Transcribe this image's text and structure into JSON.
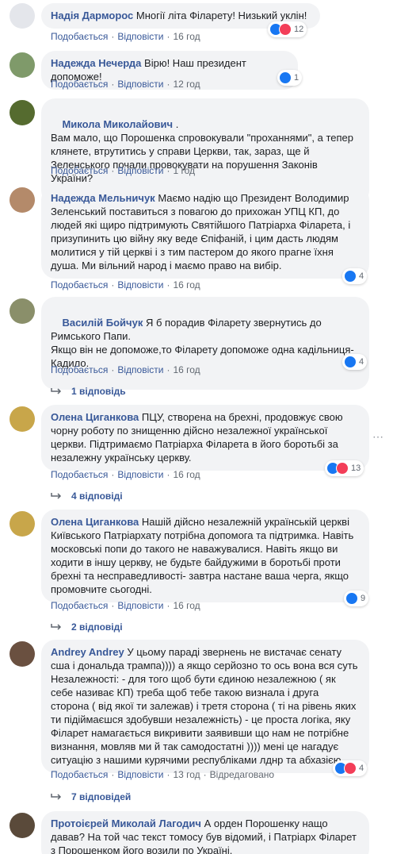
{
  "labels": {
    "like": "Подобається",
    "reply": "Відповісти",
    "edited": "Відредаговано"
  },
  "comments": [
    {
      "author": "Надія Дарморос",
      "text": "Многії літа Філарету! Низький уклін!",
      "time": "16 год",
      "reactions": "12"
    },
    {
      "author": "Надежда Нечерда",
      "text": "Вірю! Наш президент допоможе!",
      "time": "12 год",
      "reactions": "1"
    },
    {
      "author": "Микола Миколайович",
      "text": ".\nВам мало, що Порошенка спровокували \"проханнями\", а тепер клянете, втрутитись у справи Церкви, так, зараз, ще й Зеленського почали провокувати на порушення Законів України?",
      "time": "1 год",
      "reactions": ""
    },
    {
      "author": "Надежда Мельничук",
      "text": "Маємо надію що Президент Володимир Зеленський поставиться з повагою до прихожан УПЦ КП, до людей які щиро підтримують Святійшого Патріарха Філарета, і призупинить цю війну яку веде Єпіфаній, і цим дасть людям молитися у тій церкві і з тим пастером до якого прагне їхня душа. Ми вільний народ і маємо право на вибір.",
      "time": "16 год",
      "reactions": "4"
    },
    {
      "author": "Василій Бойчук",
      "text": "Я б порадив Філарету звернутись до Римського Папи.\nЯкщо він не допоможе,то Філарету допоможе одна кадільниця-Кадило.",
      "time": "16 год",
      "reactions": "4",
      "replies": "1 відповідь"
    },
    {
      "author": "Олена Циганкова",
      "text": "ПЦУ, створена на брехні, продовжує свою чорну роботу по знищенню дійсно незалежної української церкви. Підтримаємо Патріарха Філарета в його боротьбі за незалежну українську церкву.",
      "time": "16 год",
      "reactions": "13",
      "replies": "4 відповіді"
    },
    {
      "author": "Олена Циганкова",
      "text": "Нашій дійсно незалежній українській церкві Київського Патріархату потрібна допомога та підтримка. Навіть московські попи до такого не наважувалися. Навіть якщо ви ходити в іншу церкву, не будьте байдужими в боротьбі проти брехні та несправедливості- завтра настане ваша черга, якщо промовчите сьогодні.",
      "time": "16 год",
      "reactions": "9",
      "replies": "2 відповіді"
    },
    {
      "author": "Andrey Andrey",
      "text": "У цьому параді звернень не вистачає сенату сша і дональда трампа)))) а якщо серйозно то ось вона вся суть Незалежності: - для того щоб бути єдиною незалежною ( як себе називає КП) треба щоб тебе такою визнала і друга сторона ( від якої ти залежав) і третя сторона ( ті на рівень яких ти підіймаєшся здобувши незалежність) - це проста логіка, яку Філарет намагається викривити заявивши що нам не потрібне визнання, мовляв ми й так самодостатні )))) мені це нагадує ситуацію з нашими курячими республіками лднр та абхазією....",
      "time": "13 год",
      "reactions": "4",
      "replies": "7 відповідей"
    },
    {
      "author": "Протоієрей Миколай Лагодич",
      "text": "А орден Порошенку нащо давав? На той час текст томосу був відомий, і Патріарх Філарет з Порошенком його возили по Україні.",
      "time": "",
      "reactions": ""
    }
  ],
  "colors": {
    "link": "#385898",
    "bubble": "#f2f3f5",
    "like": "#1877f2",
    "love": "#f33e58"
  }
}
